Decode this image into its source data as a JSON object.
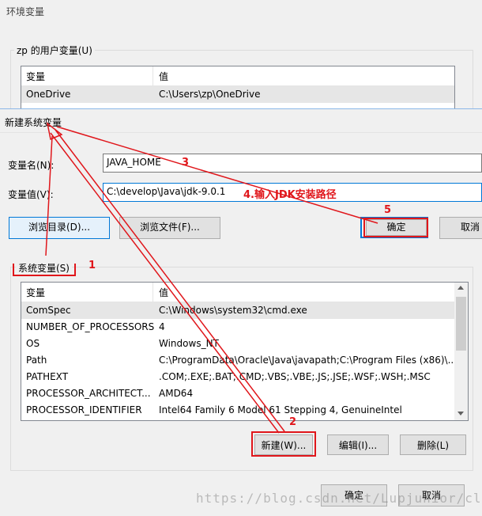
{
  "window": {
    "title": "环境变量"
  },
  "user_vars": {
    "group_label": "zp 的用户变量(U)",
    "columns": [
      "变量",
      "值"
    ],
    "rows": [
      {
        "name": "OneDrive",
        "value": "C:\\Users\\zp\\OneDrive"
      }
    ]
  },
  "dialog": {
    "title": "新建系统变量",
    "name_label": "变量名(N):",
    "name_value": "JAVA_HOME",
    "value_label": "变量值(V):",
    "value_value": "C:\\develop\\Java\\jdk-9.0.1",
    "browse_dir": "浏览目录(D)...",
    "browse_file": "浏览文件(F)...",
    "ok": "确定",
    "cancel": "取消"
  },
  "system_vars": {
    "group_label": "系统变量(S)",
    "columns": [
      "变量",
      "值"
    ],
    "rows": [
      {
        "name": "ComSpec",
        "value": "C:\\Windows\\system32\\cmd.exe"
      },
      {
        "name": "NUMBER_OF_PROCESSORS",
        "value": "4"
      },
      {
        "name": "OS",
        "value": "Windows_NT"
      },
      {
        "name": "Path",
        "value": "C:\\ProgramData\\Oracle\\Java\\javapath;C:\\Program Files (x86)\\..."
      },
      {
        "name": "PATHEXT",
        "value": ".COM;.EXE;.BAT;.CMD;.VBS;.VBE;.JS;.JSE;.WSF;.WSH;.MSC"
      },
      {
        "name": "PROCESSOR_ARCHITECT...",
        "value": "AMD64"
      },
      {
        "name": "PROCESSOR_IDENTIFIER",
        "value": "Intel64 Family 6 Model 61 Stepping 4, GenuineIntel"
      }
    ],
    "new_btn": "新建(W)...",
    "edit_btn": "编辑(I)...",
    "delete_btn": "删除(L)"
  },
  "footer": {
    "ok": "确定",
    "cancel": "取消"
  },
  "annotations": {
    "a1": "1",
    "a2": "2",
    "a3": "3",
    "a4": "4.输入JDK安装路径",
    "a5": "5"
  },
  "watermark": "https://blog.csdn.net/Lupjunior/class",
  "colors": {
    "annotation": "#e0161b",
    "focus": "#0078d7"
  }
}
